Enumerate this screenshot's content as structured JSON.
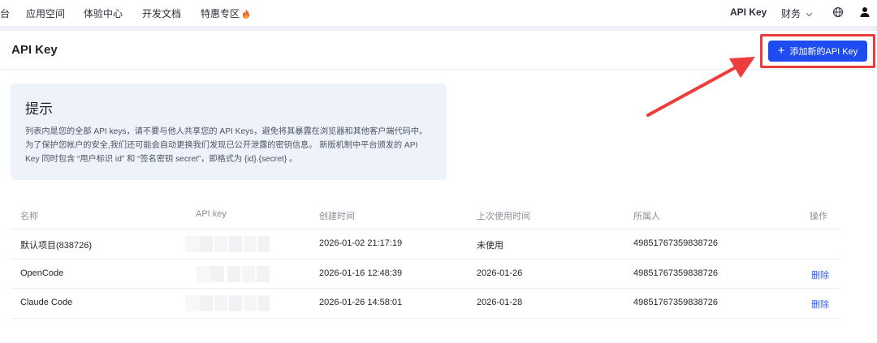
{
  "nav": {
    "left_items": [
      "台",
      "应用空间",
      "体验中心",
      "开发文档",
      "特惠专区"
    ],
    "right_api_key": "API Key",
    "right_finance": "财务",
    "icons": [
      "globe-icon",
      "user-icon",
      "chevron-down-icon",
      "fire-icon"
    ]
  },
  "header": {
    "title": "API Key",
    "add_button": "添加新的API Key"
  },
  "hint": {
    "title": "提示",
    "body": "列表内是您的全部 API keys，请不要与他人共享您的 API Keys，避免将其暴露在浏览器和其他客户端代码中。为了保护您帐户的安全,我们还可能会自动更换我们发现已公开泄露的密钥信息。 新版机制中平台颁发的 API Key 同时包含 “用户标识 id” 和 “签名密钥 secret”，即格式为 {id}.{secret} 。"
  },
  "table": {
    "columns": [
      "名称",
      "API key",
      "创建时间",
      "上次使用时间",
      "所属人",
      "操作"
    ],
    "rows": [
      {
        "name": "默认项目(838726)",
        "created": "2026-01-02 21:17:19",
        "last_used": "未使用",
        "owner": "49851767359838726",
        "action": ""
      },
      {
        "name": "OpenCode",
        "created": "2026-01-16 12:48:39",
        "last_used": "2026-01-26",
        "owner": "49851767359838726",
        "action": "删除"
      },
      {
        "name": "Claude Code",
        "created": "2026-01-26 14:58:01",
        "last_used": "2026-01-28",
        "owner": "49851767359838726",
        "action": "删除"
      }
    ]
  },
  "colors": {
    "primary": "#1f4cf0",
    "annotation_red": "#ee3b3b",
    "hint_bg": "#eef2fb",
    "link": "#2a5cf5"
  }
}
